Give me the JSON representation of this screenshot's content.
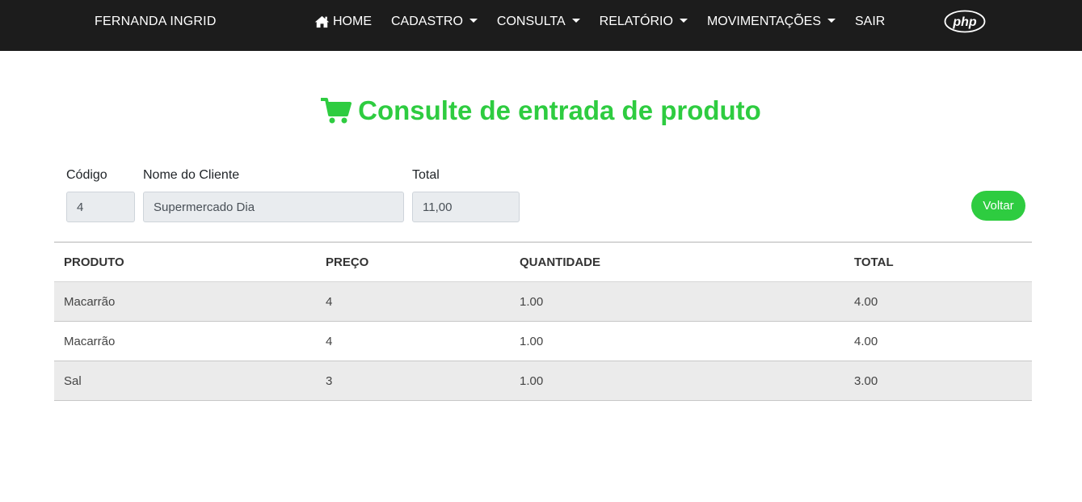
{
  "navbar": {
    "brand": "FERNANDA INGRID",
    "items": [
      {
        "label": "HOME",
        "icon": "home-icon",
        "dropdown": false
      },
      {
        "label": "CADASTRO",
        "dropdown": true
      },
      {
        "label": "CONSULTA",
        "dropdown": true
      },
      {
        "label": "RELATÓRIO",
        "dropdown": true
      },
      {
        "label": "MOVIMENTAÇÕES",
        "dropdown": true
      },
      {
        "label": "SAIR",
        "dropdown": false
      }
    ],
    "logo_text": "php"
  },
  "page": {
    "title": "Consulte de entrada de produto",
    "title_icon": "cart-icon",
    "accent_color": "#2ecc40"
  },
  "form": {
    "codigo_label": "Código",
    "codigo_value": "4",
    "cliente_label": "Nome do Cliente",
    "cliente_value": "Supermercado Dia",
    "total_label": "Total",
    "total_value": "11,00",
    "voltar_label": "Voltar"
  },
  "table": {
    "headers": [
      "PRODUTO",
      "PREÇO",
      "QUANTIDADE",
      "TOTAL"
    ],
    "rows": [
      [
        "Macarrão",
        "4",
        "1.00",
        "4.00"
      ],
      [
        "Macarrão",
        "4",
        "1.00",
        "4.00"
      ],
      [
        "Sal",
        "3",
        "1.00",
        "3.00"
      ]
    ]
  }
}
